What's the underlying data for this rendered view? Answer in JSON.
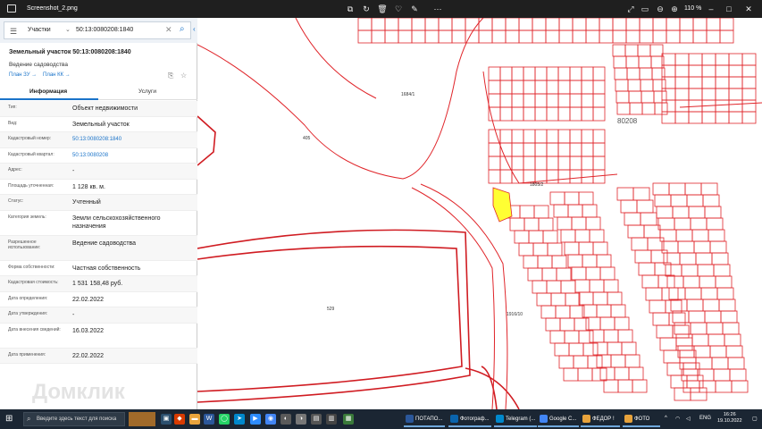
{
  "window": {
    "file_name": "Screenshot_2.png",
    "zoom": "110 %"
  },
  "search": {
    "select_label": "Участки",
    "query": "50:13:0080208:1840"
  },
  "parcel": {
    "title": "Земельный участок 50:13:0080208:1840",
    "subtitle": "Ведение садоводства",
    "link_zu": "План ЗУ →",
    "link_kk": "План КК →"
  },
  "tabs": {
    "info": "Информация",
    "services": "Услуги"
  },
  "fields": [
    {
      "label": "Тип:",
      "value": "Объект недвижимости"
    },
    {
      "label": "Вид:",
      "value": "Земельный участок"
    },
    {
      "label": "Кадастровый номер:",
      "value": "50:13:0080208:1840"
    },
    {
      "label": "Кадастровый квартал:",
      "value": "50:13:0080208"
    },
    {
      "label": "Адрес:",
      "value": "-"
    },
    {
      "label": "Площадь уточненная:",
      "value": "1 128 кв. м."
    },
    {
      "label": "Статус:",
      "value": "Учтенный"
    },
    {
      "label": "Категория земель:",
      "value": "Земли сельскохозяйственного назначения"
    },
    {
      "label": "Разрешенное использование:",
      "value": "Ведение садоводства"
    },
    {
      "label": "Форма собственности:",
      "value": "Частная собственность"
    },
    {
      "label": "Кадастровая стоимость:",
      "value": "1 531 158,48 руб."
    },
    {
      "label": "Дата определения:",
      "value": "22.02.2022"
    },
    {
      "label": "Дата утверждения:",
      "value": "-"
    },
    {
      "label": "Дата внесения сведений:",
      "value": "16.03.2022"
    },
    {
      "label": "Дата применения:",
      "value": "22.02.2022"
    }
  ],
  "map": {
    "line_color": "#e0252a",
    "highlight_color": "#ffff33",
    "labels": {
      "block": "80208",
      "n405": "405",
      "n529": "529",
      "n1684": "1684/1",
      "n1916": "1916/10",
      "n1805": "1805/2"
    }
  },
  "watermark": "Домклик",
  "taskbar": {
    "search_text": "Введите здесь текст для поиска",
    "apps": [
      "ПОТАПО...",
      "Фотограф...",
      "Telegram (...",
      "Google C...",
      "ФЕДОР !",
      "ФОТО"
    ],
    "lang": "ENG",
    "time": "16:26",
    "date": "19.10.2022"
  }
}
